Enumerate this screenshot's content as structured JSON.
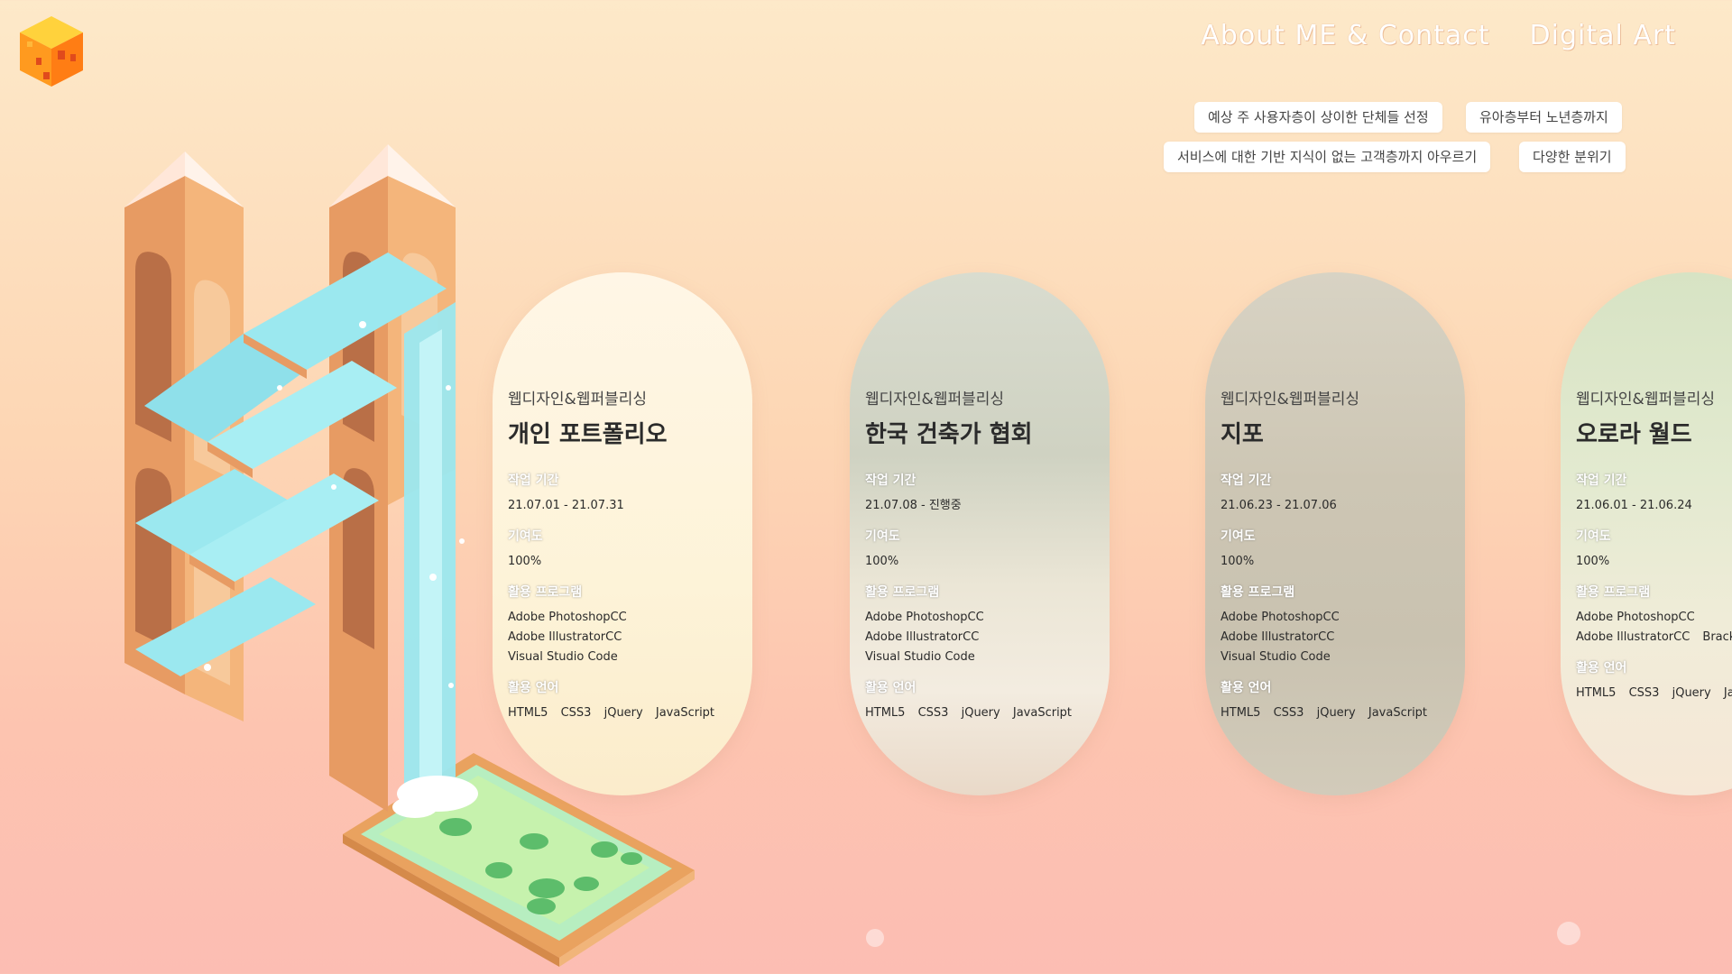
{
  "nav": {
    "about_label": "About ME & Contact",
    "digital_art_label": "Digital Art"
  },
  "tags": [
    "예상 주 사용자층이 상이한 단체들 선정",
    "유아층부터 노년층까지",
    "서비스에 대한 기반 지식이 없는 고객층까지 아우르기",
    "다양한 분위기"
  ],
  "labels": {
    "period": "작업 기간",
    "contribution": "기여도",
    "programs": "활용 프로그램",
    "languages": "활용 언어"
  },
  "cards": [
    {
      "category": "웹디자인&웹퍼블리싱",
      "title": "개인 포트폴리오",
      "period": "21.07.01 - 21.07.31",
      "contribution": "100%",
      "programs": [
        "Adobe PhotoshopCC",
        "Adobe IllustratorCC",
        "Visual Studio Code"
      ],
      "languages": [
        "HTML5",
        "CSS3",
        "jQuery",
        "JavaScript"
      ]
    },
    {
      "category": "웹디자인&웹퍼블리싱",
      "title": "한국 건축가 협회",
      "period": "21.07.08 - 진행중",
      "contribution": "100%",
      "programs": [
        "Adobe PhotoshopCC",
        "Adobe IllustratorCC",
        "Visual Studio Code"
      ],
      "languages": [
        "HTML5",
        "CSS3",
        "jQuery",
        "JavaScript"
      ]
    },
    {
      "category": "웹디자인&웹퍼블리싱",
      "title": "지포",
      "period": "21.06.23 - 21.07.06",
      "contribution": "100%",
      "programs": [
        "Adobe PhotoshopCC",
        "Adobe IllustratorCC",
        "Visual Studio Code"
      ],
      "languages": [
        "HTML5",
        "CSS3",
        "jQuery",
        "JavaScript"
      ]
    },
    {
      "category": "웹디자인&웹퍼블리싱",
      "title": "오로라 월드",
      "period": "21.06.01 - 21.06.24",
      "contribution": "100%",
      "programs": [
        "Adobe PhotoshopCC",
        "Adobe IllustratorCC",
        "Brackets"
      ],
      "languages": [
        "HTML5",
        "CSS3",
        "jQuery",
        "JavaScript"
      ]
    }
  ],
  "colors": {
    "accent": "#fdc4b0",
    "card_bg_1": "#fdf6e3",
    "water": "#9be8ef"
  }
}
